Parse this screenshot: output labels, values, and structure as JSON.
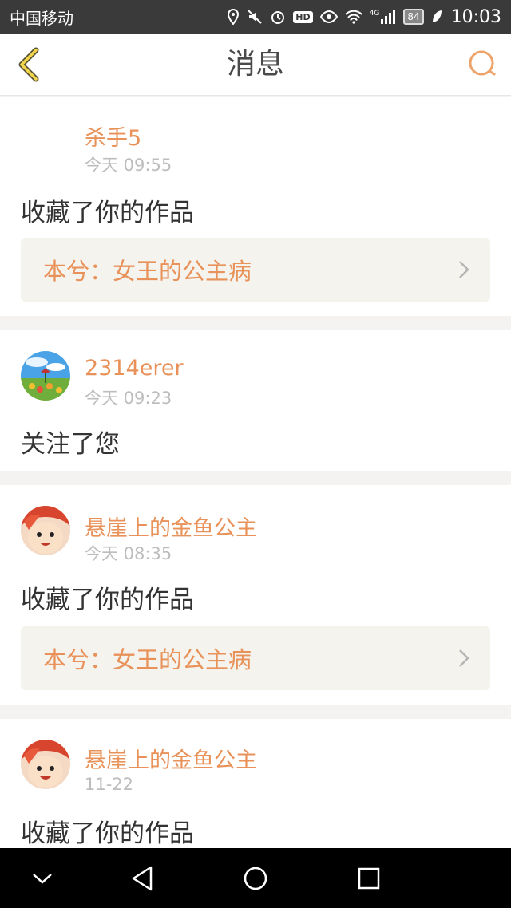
{
  "status_bar": {
    "carrier": "中国移动",
    "network": "4G",
    "hd": "HD",
    "battery": "84",
    "time": "10:03"
  },
  "header": {
    "title": "消息"
  },
  "colors": {
    "accent": "#e8925a",
    "title": "#4a4a4a",
    "muted": "#bdbdbd",
    "card_link_bg": "#f4f3ee"
  },
  "messages": [
    {
      "user": "杀手5",
      "time": "今天 09:55",
      "action": "收藏了你的作品",
      "work": "本兮：女王的公主病",
      "avatar": "none"
    },
    {
      "user": "2314erer",
      "time": "今天 09:23",
      "action": "关注了您",
      "avatar": "landscape-avatar"
    },
    {
      "user": "悬崖上的金鱼公主",
      "time": "今天 08:35",
      "action": "收藏了你的作品",
      "work": "本兮：女王的公主病",
      "avatar": "ponyo-avatar"
    },
    {
      "user": "悬崖上的金鱼公主",
      "time": "11-22",
      "action": "收藏了你的作品",
      "avatar": "ponyo-avatar"
    }
  ]
}
